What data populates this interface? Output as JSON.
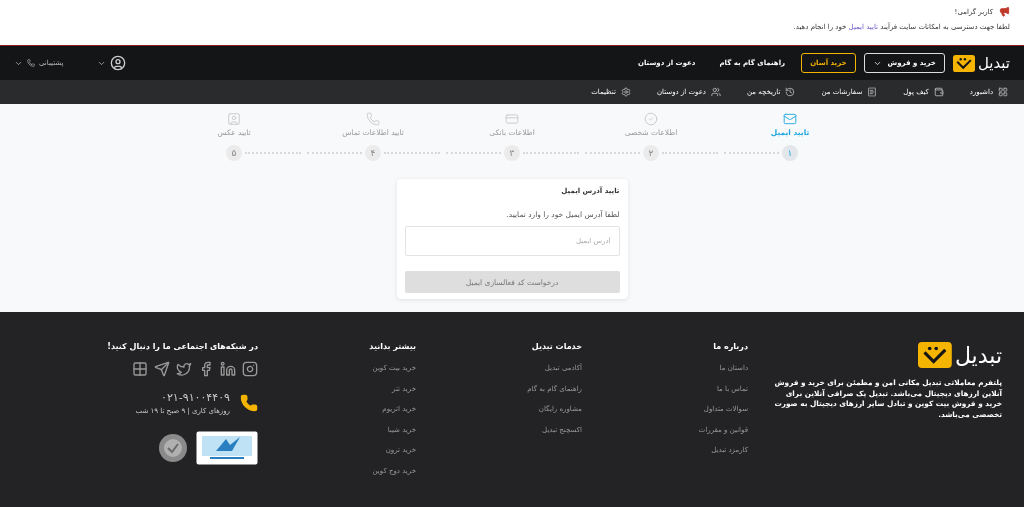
{
  "alert": {
    "title": "کاربر گرامی!",
    "message_before": "لطفا جهت دسترسی به امکانات سایت فرآیند",
    "link": "تایید ایمیل",
    "message_after": "خود را انجام دهید."
  },
  "header": {
    "logo": "تبدیل",
    "menu": [
      {
        "kind": "dropdown",
        "label": "خرید و فروش"
      },
      {
        "kind": "highlight",
        "label": "خرید آسان"
      },
      {
        "kind": "link",
        "label": "راهنمای گام به گام"
      },
      {
        "kind": "link",
        "label": "دعوت از دوستان"
      }
    ],
    "support": "پشتیبانی"
  },
  "subnav": [
    "داشبورد",
    "کیف پول",
    "سفارشات من",
    "تاریخچه من",
    "دعوت از دوستان",
    "تنظیمات"
  ],
  "steps": [
    {
      "label": "تایید ایمیل",
      "number": "۱",
      "selected": true
    },
    {
      "label": "اطلاعات شخصی",
      "number": "۲",
      "selected": false
    },
    {
      "label": "اطلاعات بانکی",
      "number": "۳",
      "selected": false
    },
    {
      "label": "تایید اطلاعات تماس",
      "number": "۴",
      "selected": false
    },
    {
      "label": "تایید عکس",
      "number": "۵",
      "selected": false
    }
  ],
  "form": {
    "title": "تایید آدرس ایمیل",
    "hint": "لطفا آدرس ایمیل خود را وارد نمایید.",
    "placeholder": "آدرس ایمیل",
    "button": {
      "label": "درخواست کد فعالسازی ایمیل",
      "disabled": true
    }
  },
  "footer": {
    "logo": "تبدیل",
    "description": "پلتفرم معاملاتی تبدیل مکانی امن و مطمئن برای خرید و فروش آنلاین ارزهای دیجیتال می‌باشد. تبدیل یک صرافی آنلاین برای خرید و فروش بیت کوین و تبادل سایر ارزهای دیجیتال به صورت تخصصی می‌باشد.",
    "columns": [
      {
        "title": "درباره ما",
        "links": [
          "داستان ما",
          "تماس با ما",
          "سوالات متداول",
          "قوانین و مقررات",
          "کارمزد تبدیل"
        ]
      },
      {
        "title": "خدمات تبدیل",
        "links": [
          "آکادمی تبدیل",
          "راهنمای گام به گام",
          "مشاوره رایگان",
          "اکسچنج تبدیل"
        ]
      },
      {
        "title": "بیشتر بدانید",
        "links": [
          "خرید بیت کوین",
          "خرید تتر",
          "خرید اتریوم",
          "خرید شیبا",
          "خرید ترون",
          "خرید دوج کوین"
        ]
      }
    ],
    "social_title": "در شبکه‌های اجتماعی ما را دنبال کنید!",
    "phone": "۰۲۱-۹۱۰۰۴۴۰۹",
    "hours": "روزهای کاری  |  ۹ صبح تا ۱۹ شب"
  }
}
